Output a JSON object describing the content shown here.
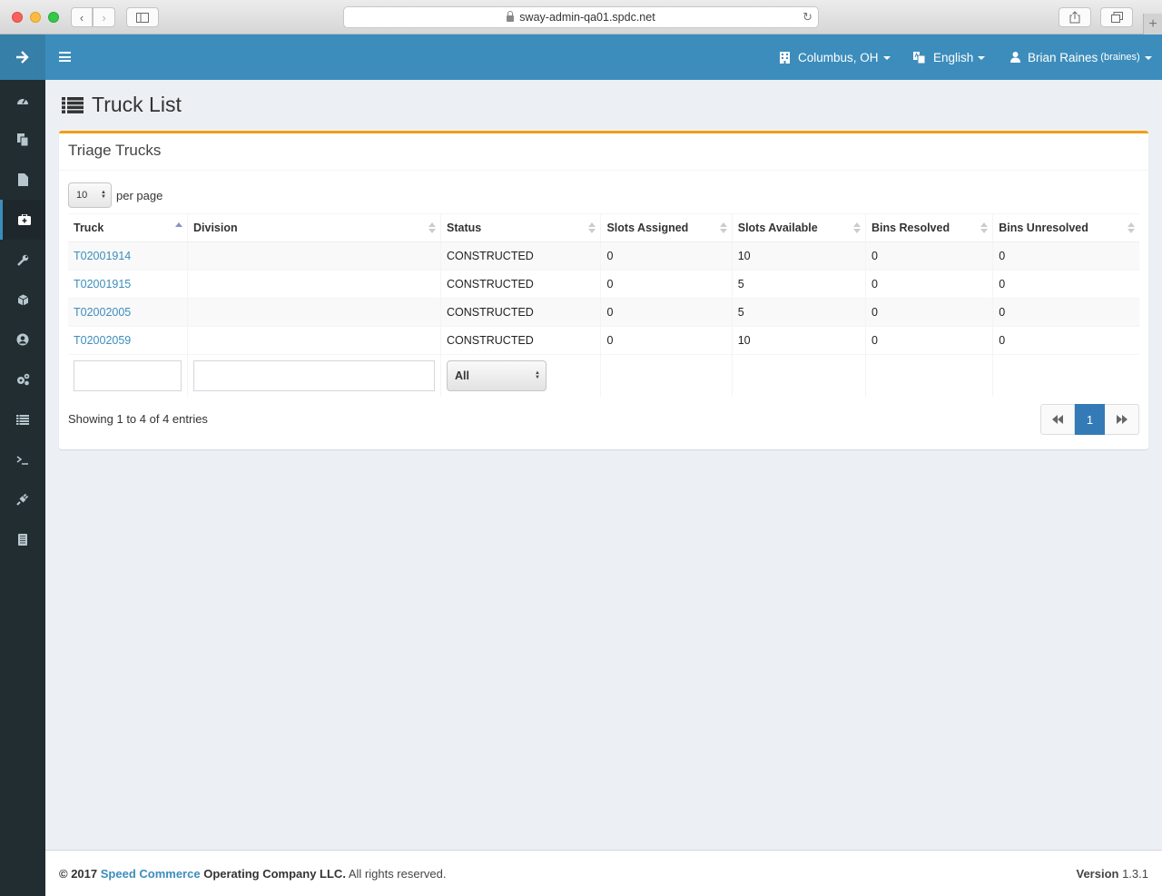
{
  "browser": {
    "url": "sway-admin-qa01.spdc.net"
  },
  "header": {
    "location_label": "Columbus, OH",
    "language_label": "English",
    "user_name": "Brian Raines",
    "user_login": "(braines)"
  },
  "sidebar": {
    "items": [
      {
        "icon": "dashboard-icon"
      },
      {
        "icon": "copy-icon"
      },
      {
        "icon": "file-icon"
      },
      {
        "icon": "medkit-icon",
        "active": true
      },
      {
        "icon": "wrench-icon"
      },
      {
        "icon": "cube-icon"
      },
      {
        "icon": "user-circle-icon"
      },
      {
        "icon": "gears-icon"
      },
      {
        "icon": "list-icon"
      },
      {
        "icon": "terminal-icon"
      },
      {
        "icon": "plug-icon"
      },
      {
        "icon": "book-icon"
      }
    ],
    "active_color": "#3c8dbc"
  },
  "page": {
    "title": "Truck List"
  },
  "box": {
    "title": "Triage Trucks",
    "accent_color": "#f39c12",
    "per_page_value": "10",
    "per_page_label": "per page",
    "columns": [
      "Truck",
      "Division",
      "Status",
      "Slots Assigned",
      "Slots Available",
      "Bins Resolved",
      "Bins Unresolved"
    ],
    "rows": [
      {
        "truck": "T02001914",
        "division": "",
        "status": "CONSTRUCTED",
        "slots_assigned": "0",
        "slots_available": "10",
        "bins_resolved": "0",
        "bins_unresolved": "0"
      },
      {
        "truck": "T02001915",
        "division": "",
        "status": "CONSTRUCTED",
        "slots_assigned": "0",
        "slots_available": "5",
        "bins_resolved": "0",
        "bins_unresolved": "0"
      },
      {
        "truck": "T02002005",
        "division": "",
        "status": "CONSTRUCTED",
        "slots_assigned": "0",
        "slots_available": "5",
        "bins_resolved": "0",
        "bins_unresolved": "0"
      },
      {
        "truck": "T02002059",
        "division": "",
        "status": "CONSTRUCTED",
        "slots_assigned": "0",
        "slots_available": "10",
        "bins_resolved": "0",
        "bins_unresolved": "0"
      }
    ],
    "status_filter_value": "All",
    "info_text": "Showing 1 to 4 of 4 entries",
    "current_page": "1"
  },
  "footer": {
    "copyright_prefix": "© 2017",
    "company_link": "Speed Commerce",
    "company_rest": "Operating Company LLC.",
    "rights": "All rights reserved.",
    "version_label": "Version",
    "version_value": "1.3.1"
  }
}
